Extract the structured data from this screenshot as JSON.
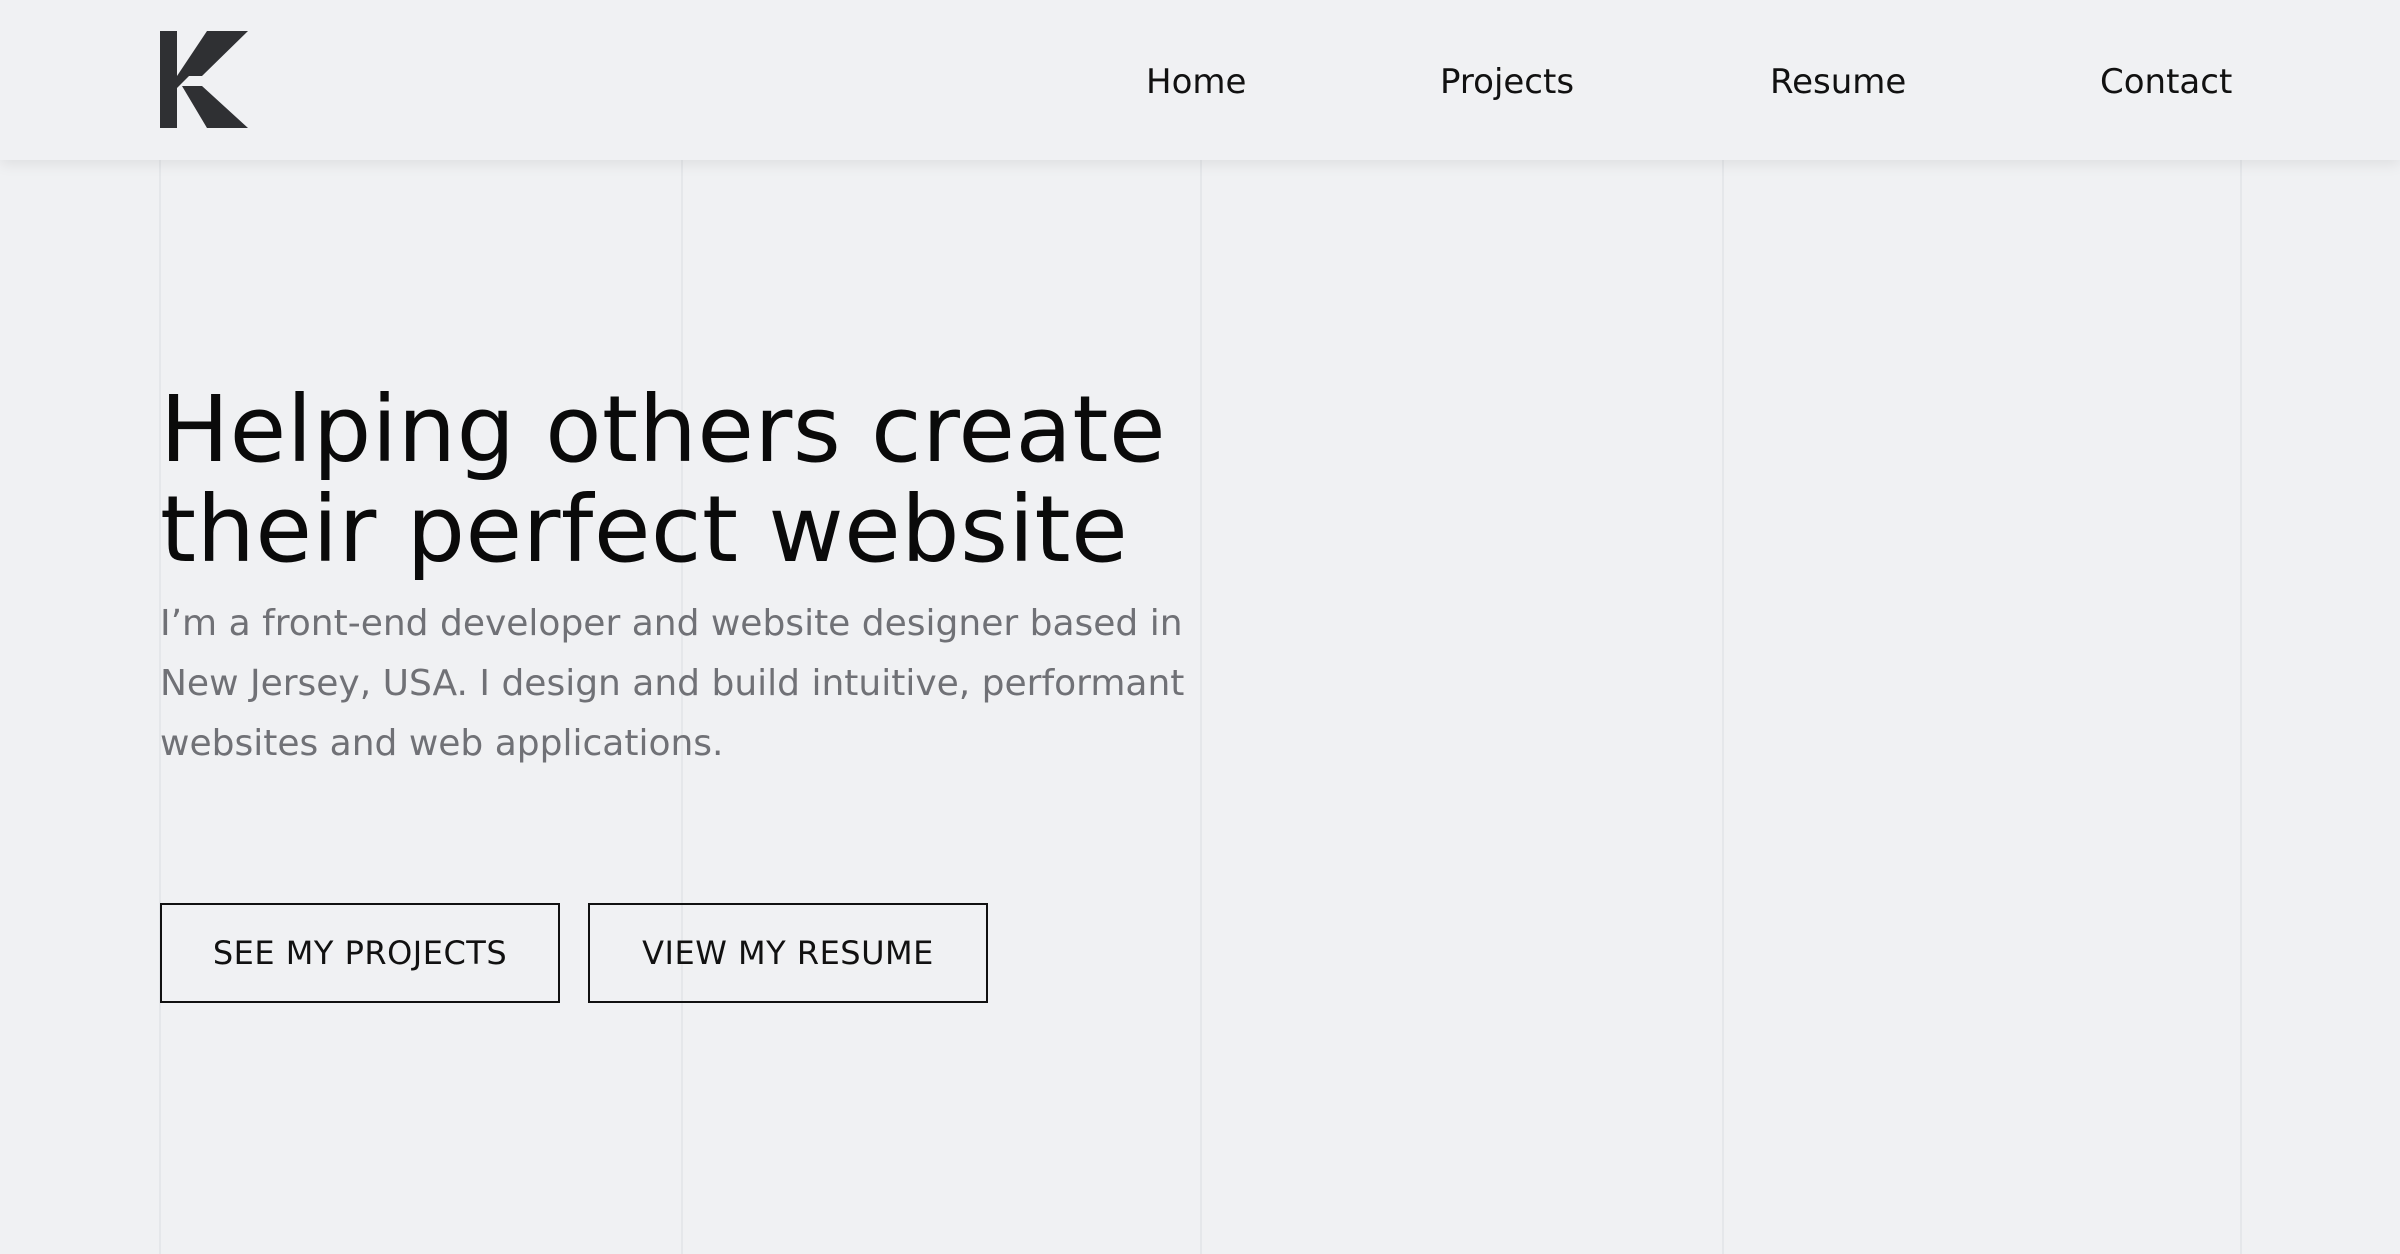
{
  "colors": {
    "background": "#f0f1f3",
    "text": "#0a0a0a",
    "muted_text": "#707176",
    "logo": "#2f3033"
  },
  "header": {
    "logo_icon": "k-monogram-logo",
    "nav": [
      "Home",
      "Projects",
      "Resume",
      "Contact"
    ]
  },
  "hero": {
    "title_line1": "Helping others create",
    "title_line2": "their perfect website",
    "subtitle": "I’m a front-end developer and website designer based in New Jersey, USA. I design and build intuitive, performant websites and web applications.",
    "buttons": {
      "projects": "SEE MY PROJECTS",
      "resume": "VIEW MY RESUME"
    }
  }
}
